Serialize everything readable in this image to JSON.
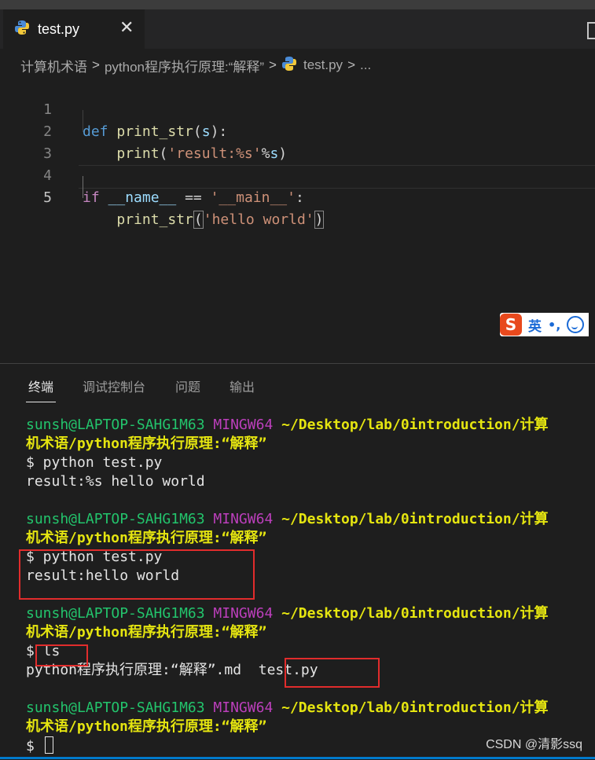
{
  "tab": {
    "label": "test.py",
    "close": "✕"
  },
  "breadcrumb": {
    "parts": [
      "计算机术语",
      "python程序执行原理:“解释”",
      "test.py",
      "..."
    ]
  },
  "editor": {
    "line_numbers": [
      "1",
      "2",
      "3",
      "4",
      "5"
    ],
    "active_line": 5
  },
  "code": {
    "l1": {
      "kw": "def",
      "fn": "print_str",
      "open": "(",
      "param": "s",
      "close": "):"
    },
    "l2": {
      "fn": "print",
      "open": "(",
      "str": "'result:%s'",
      "op": "%",
      "var": "s",
      "close": ")"
    },
    "l4": {
      "kw": "if",
      "sp": " ",
      "name": "__name__",
      "eq": " == ",
      "str": "'__main__'",
      "colon": ":"
    },
    "l5": {
      "fn": "print_str",
      "open": "(",
      "str": "'hello world'",
      "close": ")"
    }
  },
  "ime": {
    "logo": "S",
    "lang": "英",
    "punc": "•,",
    "emoji": "smiley-icon"
  },
  "panel": {
    "tabs": [
      "终端",
      "调试控制台",
      "问题",
      "输出"
    ]
  },
  "terminal": {
    "user": "sunsh@LAPTOP-SAHG1M63",
    "shell": "MINGW64",
    "path1": "~/Desktop/lab/0introduction/计算",
    "path2": "机术语/python程序执行原理:“解释”",
    "cmd1": "$ python test.py",
    "out1": "result:%s hello world",
    "cmd2": "$ python test.py",
    "out2": "result:hello world",
    "cmd3": "$ ls",
    "out3a": "python程序执行原理:“解释”.md",
    "out3b": "test.py",
    "prompt": "$"
  },
  "watermark": "CSDN @清影ssq",
  "colors": {
    "background": "#1e1e1e",
    "terminal_user": "#23c46c",
    "terminal_shell": "#bc3fbc",
    "terminal_path": "#e5e510",
    "highlight_box": "#e12c2c",
    "keyword": "#569cd6",
    "string": "#ce9178",
    "function": "#dcdcaa"
  }
}
